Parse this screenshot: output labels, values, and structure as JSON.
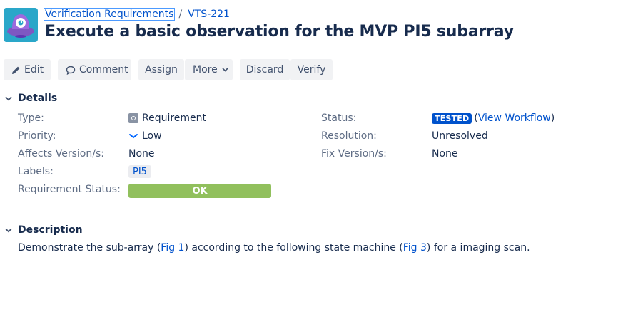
{
  "header": {
    "breadcrumb_project": "Verification Requirements",
    "breadcrumb_separator": "/",
    "issue_key": "VTS-221",
    "title": "Execute a basic observation for the MVP PI5 subarray",
    "avatar_icon": "alien-spaceship-avatar-icon"
  },
  "toolbar": {
    "edit_label": "Edit",
    "comment_label": "Comment",
    "assign_label": "Assign",
    "more_label": "More",
    "discard_label": "Discard",
    "verify_label": "Verify"
  },
  "details": {
    "heading": "Details",
    "type_label": "Type:",
    "type_value": "Requirement",
    "priority_label": "Priority:",
    "priority_value": "Low",
    "affects_label": "Affects Version/s:",
    "affects_value": "None",
    "labels_label": "Labels:",
    "labels_value": "PI5",
    "req_status_label": "Requirement Status:",
    "req_status_value": "OK",
    "status_label": "Status:",
    "status_value": "TESTED",
    "status_link_open": "(",
    "status_link": "View Workflow",
    "status_link_close": ")",
    "resolution_label": "Resolution:",
    "resolution_value": "Unresolved",
    "fix_label": "Fix Version/s:",
    "fix_value": "None"
  },
  "description": {
    "heading": "Description",
    "text_1": "Demonstrate the sub-array (",
    "link_1": "Fig 1",
    "text_2": ") according to the following state machine (",
    "link_2": "Fig 3",
    "text_3": ") for a imaging scan."
  },
  "colors": {
    "brand_blue": "#0052cc",
    "text_dark": "#172b4d",
    "text_muted": "#5e6c84",
    "button_bg": "#f1f2f4",
    "ok_green": "#91c05d",
    "avatar_bg": "#2aa7c9"
  }
}
